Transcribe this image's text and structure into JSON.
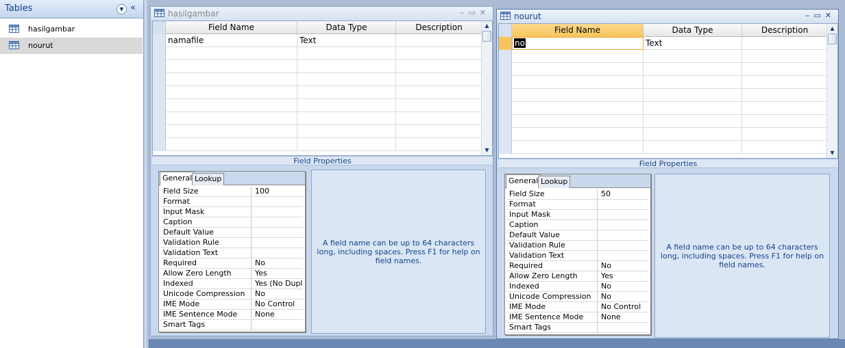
{
  "nav": {
    "title": "Tables",
    "items": [
      {
        "label": "hasilgambar"
      },
      {
        "label": "nourut"
      }
    ]
  },
  "windows": [
    {
      "title": "hasilgambar",
      "columns": [
        "Field Name",
        "Data Type",
        "Description"
      ],
      "rows": [
        {
          "field_name": "namafile",
          "data_type": "Text",
          "description": ""
        }
      ],
      "field_properties_label": "Field Properties",
      "tabs": [
        "General",
        "Lookup"
      ],
      "properties": [
        {
          "name": "Field Size",
          "value": "100"
        },
        {
          "name": "Format",
          "value": ""
        },
        {
          "name": "Input Mask",
          "value": ""
        },
        {
          "name": "Caption",
          "value": ""
        },
        {
          "name": "Default Value",
          "value": ""
        },
        {
          "name": "Validation Rule",
          "value": ""
        },
        {
          "name": "Validation Text",
          "value": ""
        },
        {
          "name": "Required",
          "value": "No"
        },
        {
          "name": "Allow Zero Length",
          "value": "Yes"
        },
        {
          "name": "Indexed",
          "value": "Yes (No Dupli"
        },
        {
          "name": "Unicode Compression",
          "value": "No"
        },
        {
          "name": "IME Mode",
          "value": "No Control"
        },
        {
          "name": "IME Sentence Mode",
          "value": "None"
        },
        {
          "name": "Smart Tags",
          "value": ""
        }
      ],
      "help_text": "A field name can be up to 64 characters long, including spaces.  Press F1 for help on field names."
    },
    {
      "title": "nourut",
      "columns": [
        "Field Name",
        "Data Type",
        "Description"
      ],
      "rows": [
        {
          "field_name": "no",
          "data_type": "Text",
          "description": ""
        }
      ],
      "field_properties_label": "Field Properties",
      "tabs": [
        "General",
        "Lookup"
      ],
      "properties": [
        {
          "name": "Field Size",
          "value": "50"
        },
        {
          "name": "Format",
          "value": ""
        },
        {
          "name": "Input Mask",
          "value": ""
        },
        {
          "name": "Caption",
          "value": ""
        },
        {
          "name": "Default Value",
          "value": ""
        },
        {
          "name": "Validation Rule",
          "value": ""
        },
        {
          "name": "Validation Text",
          "value": ""
        },
        {
          "name": "Required",
          "value": "No"
        },
        {
          "name": "Allow Zero Length",
          "value": "Yes"
        },
        {
          "name": "Indexed",
          "value": "No"
        },
        {
          "name": "Unicode Compression",
          "value": "No"
        },
        {
          "name": "IME Mode",
          "value": "No Control"
        },
        {
          "name": "IME Sentence Mode",
          "value": "None"
        },
        {
          "name": "Smart Tags",
          "value": ""
        }
      ],
      "help_text": "A field name can be up to 64 characters long, including spaces.  Press F1 for help on field names."
    }
  ],
  "colors": {
    "accent": "#15428b",
    "selected_header": "#f7c55c",
    "pane": "#c9d8ed"
  },
  "icons": [
    "table-icon",
    "chevron-down-icon",
    "double-chevron-left-icon",
    "minimize-icon",
    "restore-icon",
    "close-icon"
  ]
}
